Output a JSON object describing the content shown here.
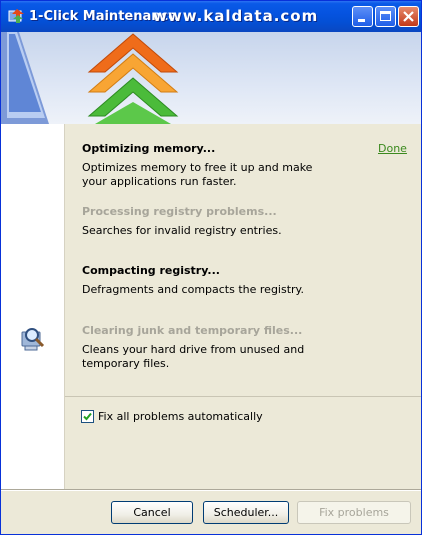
{
  "window": {
    "title": "1-Click Maintenance",
    "watermark": "www.kaldata.com"
  },
  "tasks": [
    {
      "title": "Optimizing memory...",
      "description": "Optimizes memory to free it up and make your applications run faster.",
      "state": "active"
    },
    {
      "title": "Processing registry problems...",
      "description": "Searches for invalid registry entries.",
      "state": "disabled"
    },
    {
      "title": "Compacting registry...",
      "description": "Defragments and compacts the registry.",
      "state": "active"
    },
    {
      "title": "Clearing junk and temporary files...",
      "description": "Cleans your hard drive from unused and temporary files.",
      "state": "disabled"
    }
  ],
  "done_link": "Done",
  "options": {
    "fix_all_label": "Fix all problems automatically",
    "fix_all_checked": true
  },
  "buttons": {
    "cancel": "Cancel",
    "scheduler": "Scheduler...",
    "fix_problems": "Fix problems"
  },
  "colors": {
    "title_bar": "#0553e0",
    "done_link": "#3b8a1e",
    "disabled_text": "#a7a59a"
  },
  "icons": {
    "app": "app-icon",
    "minimize": "minimize-icon",
    "maximize": "maximize-icon",
    "close": "close-icon",
    "sidebar": "magnifier-icon"
  }
}
